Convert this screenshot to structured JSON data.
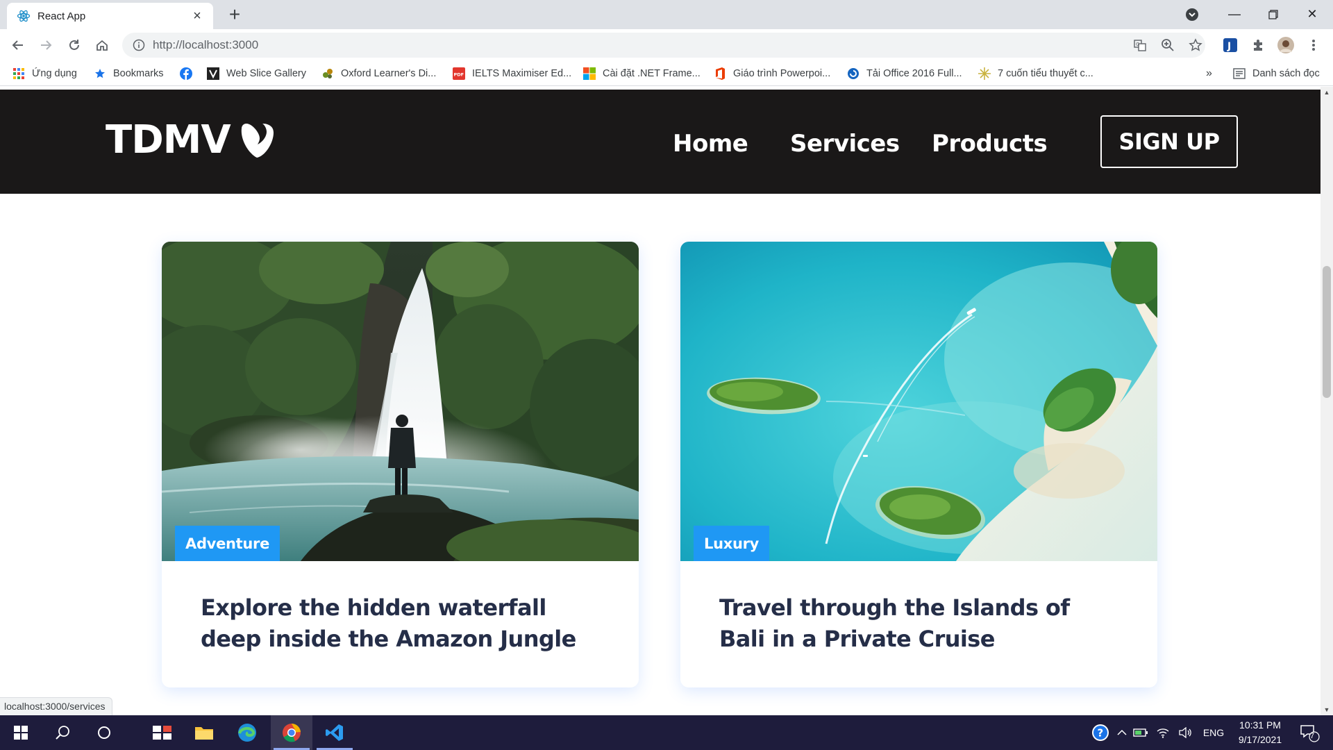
{
  "browser": {
    "tab_title": "React App",
    "url": "http://localhost:3000",
    "status_url": "localhost:3000/services",
    "bookmarks": [
      {
        "label": "Ứng dụng",
        "icon": "apps-grid-icon"
      },
      {
        "label": "Bookmarks",
        "icon": "star-icon"
      },
      {
        "label": "",
        "icon": "facebook-icon"
      },
      {
        "label": "Web Slice Gallery",
        "icon": "web-slice-icon"
      },
      {
        "label": "Oxford Learner's Di...",
        "icon": "oxford-icon"
      },
      {
        "label": "IELTS Maximiser Ed...",
        "icon": "pdf-icon"
      },
      {
        "label": "Cài đặt .NET Frame...",
        "icon": "microsoft-icon"
      },
      {
        "label": "Giáo trình Powerpoi...",
        "icon": "office-icon"
      },
      {
        "label": "Tải Office 2016 Full...",
        "icon": "download-site-icon"
      },
      {
        "label": "7 cuốn tiểu thuyết c...",
        "icon": "sparkle-icon"
      }
    ],
    "overflow_label": "»",
    "reading_list_label": "Danh sách đọc"
  },
  "site": {
    "logo_text": "TDMV",
    "nav": {
      "home": "Home",
      "services": "Services",
      "products": "Products",
      "signup": "SIGN UP"
    },
    "cards": [
      {
        "badge": "Adventure",
        "title": "Explore the hidden waterfall deep inside the Amazon Jungle",
        "image": "waterfall-photo"
      },
      {
        "badge": "Luxury",
        "title": "Travel through the Islands of Bali in a Private Cruise",
        "image": "islands-aerial-photo"
      }
    ]
  },
  "taskbar": {
    "language": "ENG",
    "time": "10:31 PM",
    "date": "9/17/2021",
    "notification_count": "7"
  },
  "colors": {
    "nav_background": "#1a1818",
    "badge_blue": "#1f98f4",
    "card_title": "#252e48",
    "taskbar": "#1e1c3c"
  }
}
